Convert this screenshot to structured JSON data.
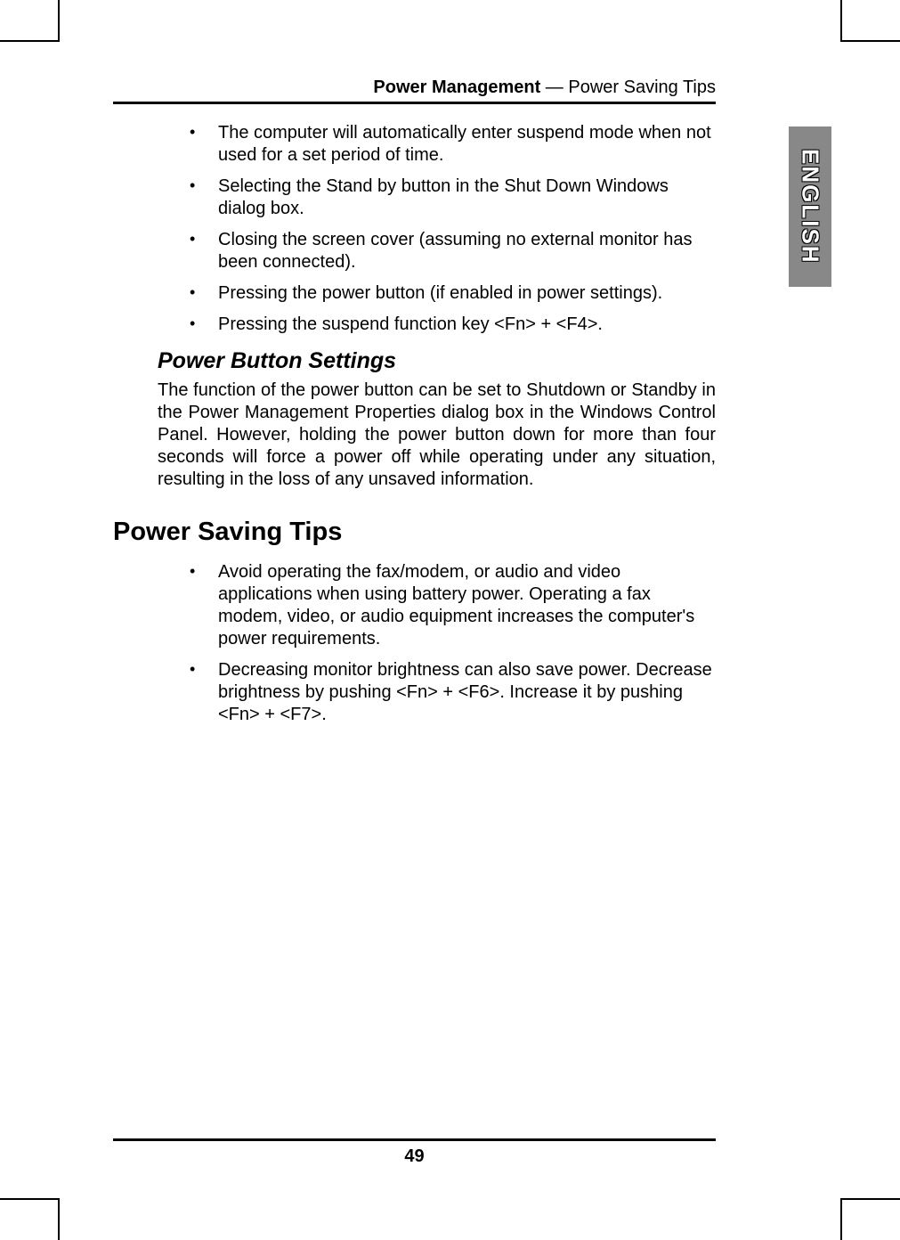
{
  "header": {
    "section_bold": "Power Management",
    "section_rest": " — Power Saving Tips"
  },
  "side_tab": "ENGLISH",
  "suspend_bullets": [
    "The computer will automatically enter suspend mode when not used for a set period of time.",
    "Selecting the Stand by button in the Shut Down Windows dialog box.",
    "Closing the screen cover (assuming no external monitor has been connected).",
    "Pressing the power button (if enabled in power settings).",
    "Pressing the suspend function key <Fn> + <F4>."
  ],
  "power_button": {
    "heading": "Power Button Settings",
    "paragraph": "The function of the power button can be set to Shutdown or Standby in the Power Management Properties dialog box in the Windows Control Panel. However, holding the power button down for more than four seconds will force a power off while operating under any situation, resulting in the loss of any unsaved information."
  },
  "tips": {
    "heading": "Power Saving Tips",
    "bullets": [
      "Avoid operating the fax/modem, or audio and video applications when using battery power. Operating a fax modem, video, or audio equipment increases the computer's power requirements.",
      "Decreasing monitor brightness can also save power. Decrease brightness by pushing <Fn> + <F6>. Increase it by pushing <Fn> + <F7>."
    ]
  },
  "page_number": "49"
}
